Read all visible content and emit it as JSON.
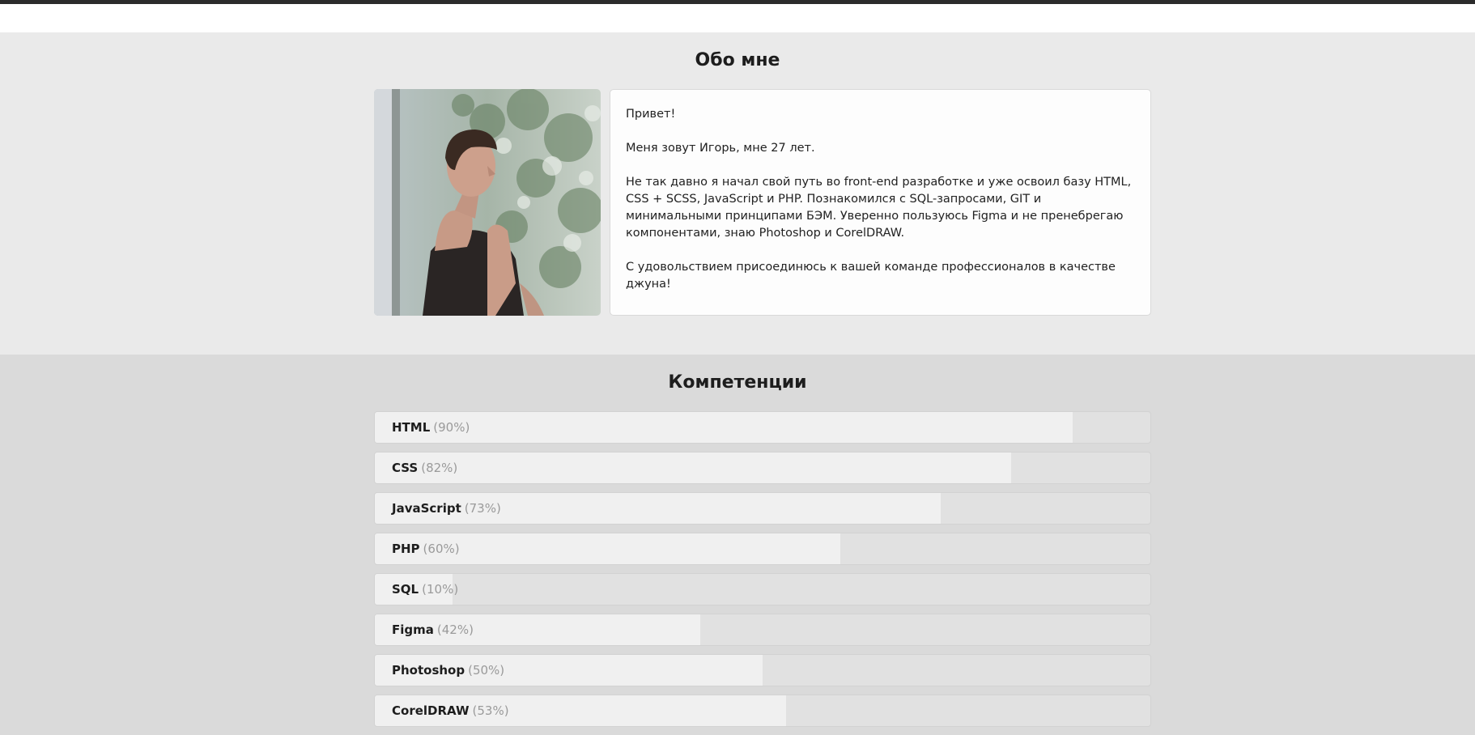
{
  "about": {
    "title": "Обо мне",
    "paragraphs": [
      "Привет!",
      "Меня зовут Игорь, мне 27 лет.",
      "Не так давно я начал свой путь во front-end разработке и уже освоил базу HTML, CSS + SCSS, JavaScript и PHP. Познакомился с SQL-запросами, GIT и минимальными принципами БЭМ. Уверенно пользуюсь Figma и не пренебрегаю компонентами, знаю Photoshop и CorelDRAW.",
      "С удовольствием присоединюсь к вашей команде профессионалов в качестве джуна!"
    ]
  },
  "skills": {
    "title": "Компетенции",
    "items": [
      {
        "name": "HTML",
        "percent_label": "(90%)",
        "level": 90
      },
      {
        "name": "CSS",
        "percent_label": "(82%)",
        "level": 82
      },
      {
        "name": "JavaScript",
        "percent_label": "(73%)",
        "level": 73
      },
      {
        "name": "PHP",
        "percent_label": "(60%)",
        "level": 60
      },
      {
        "name": "SQL",
        "percent_label": "(10%)",
        "level": 10
      },
      {
        "name": "Figma",
        "percent_label": "(42%)",
        "level": 42
      },
      {
        "name": "Photoshop",
        "percent_label": "(50%)",
        "level": 50
      },
      {
        "name": "CorelDRAW",
        "percent_label": "(53%)",
        "level": 53
      }
    ]
  },
  "colors": {
    "top_bar": "#2b2b2b",
    "about_bg": "#eaeaea",
    "skills_bg": "#dadada",
    "skill_fill": "#f0f0f0",
    "skill_track": "#e1e1e1",
    "percent_text": "#9a9a9a"
  }
}
